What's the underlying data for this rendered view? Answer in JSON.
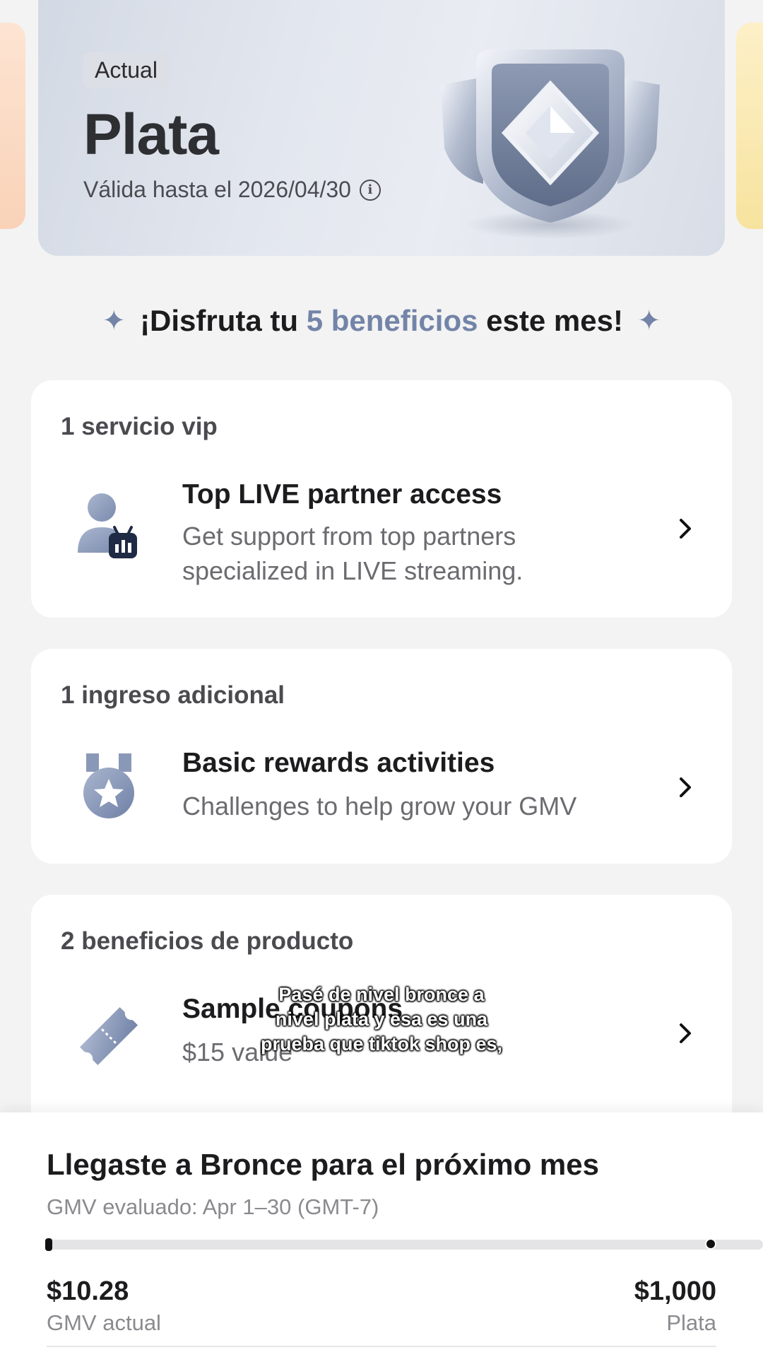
{
  "tier": {
    "current_label": "Actual",
    "name": "Plata",
    "valid_until": "Válida hasta el 2026/04/30"
  },
  "benefits_heading": {
    "prefix": "¡Disfruta tu ",
    "highlight": "5 beneficios",
    "suffix": " este mes!"
  },
  "sections": [
    {
      "title": "1 servicio vip",
      "item_title": "Top LIVE partner access",
      "item_desc_line1": "Get support from top partners",
      "item_desc_line2": "specialized in LIVE streaming.",
      "icon": "live-partner-icon"
    },
    {
      "title": "1 ingreso adicional",
      "item_title": "Basic rewards activities",
      "item_desc_line1": "Challenges to help grow your GMV",
      "icon": "medal-icon"
    },
    {
      "title": "2 beneficios de producto",
      "item_title": "Sample coupons",
      "item_desc_line1": "$15 value",
      "icon": "ticket-icon"
    }
  ],
  "subtitle": {
    "line1": "Pasé de nivel bronce a",
    "line2": "nivel plata y esa es una",
    "line3": "prueba que tiktok shop es,"
  },
  "progress_sheet": {
    "title": "Llegaste a Bronce para el próximo mes",
    "evaluated": "GMV evaluado: Apr 1–30 (GMT-7)",
    "current_amount": "$10.28",
    "current_label": "GMV actual",
    "target_amount": "$1,000",
    "target_label": "Plata",
    "progress_fraction": 0.01
  },
  "colors": {
    "accent": "#7384a8",
    "background": "#f3f3f3"
  }
}
